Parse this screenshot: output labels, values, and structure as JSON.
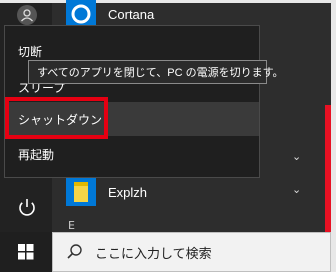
{
  "start_menu": {
    "apps": [
      {
        "label": "Cortana",
        "icon": "cortana-icon"
      },
      {
        "label": "Explzh",
        "icon": "folder-icon"
      }
    ],
    "partial_label": "E"
  },
  "power_menu": {
    "items": [
      {
        "label": "切断"
      },
      {
        "label": "スリープ"
      },
      {
        "label": "シャットダウン"
      },
      {
        "label": "再起動"
      }
    ],
    "tooltip": "すべてのアプリを閉じて、PC の電源を切ります。"
  },
  "taskbar": {
    "search_placeholder": "ここに入力して検索"
  },
  "colors": {
    "highlight": "#e60012",
    "accent": "#e81123",
    "cortana": "#0078d7",
    "folder": "#f5d547"
  }
}
